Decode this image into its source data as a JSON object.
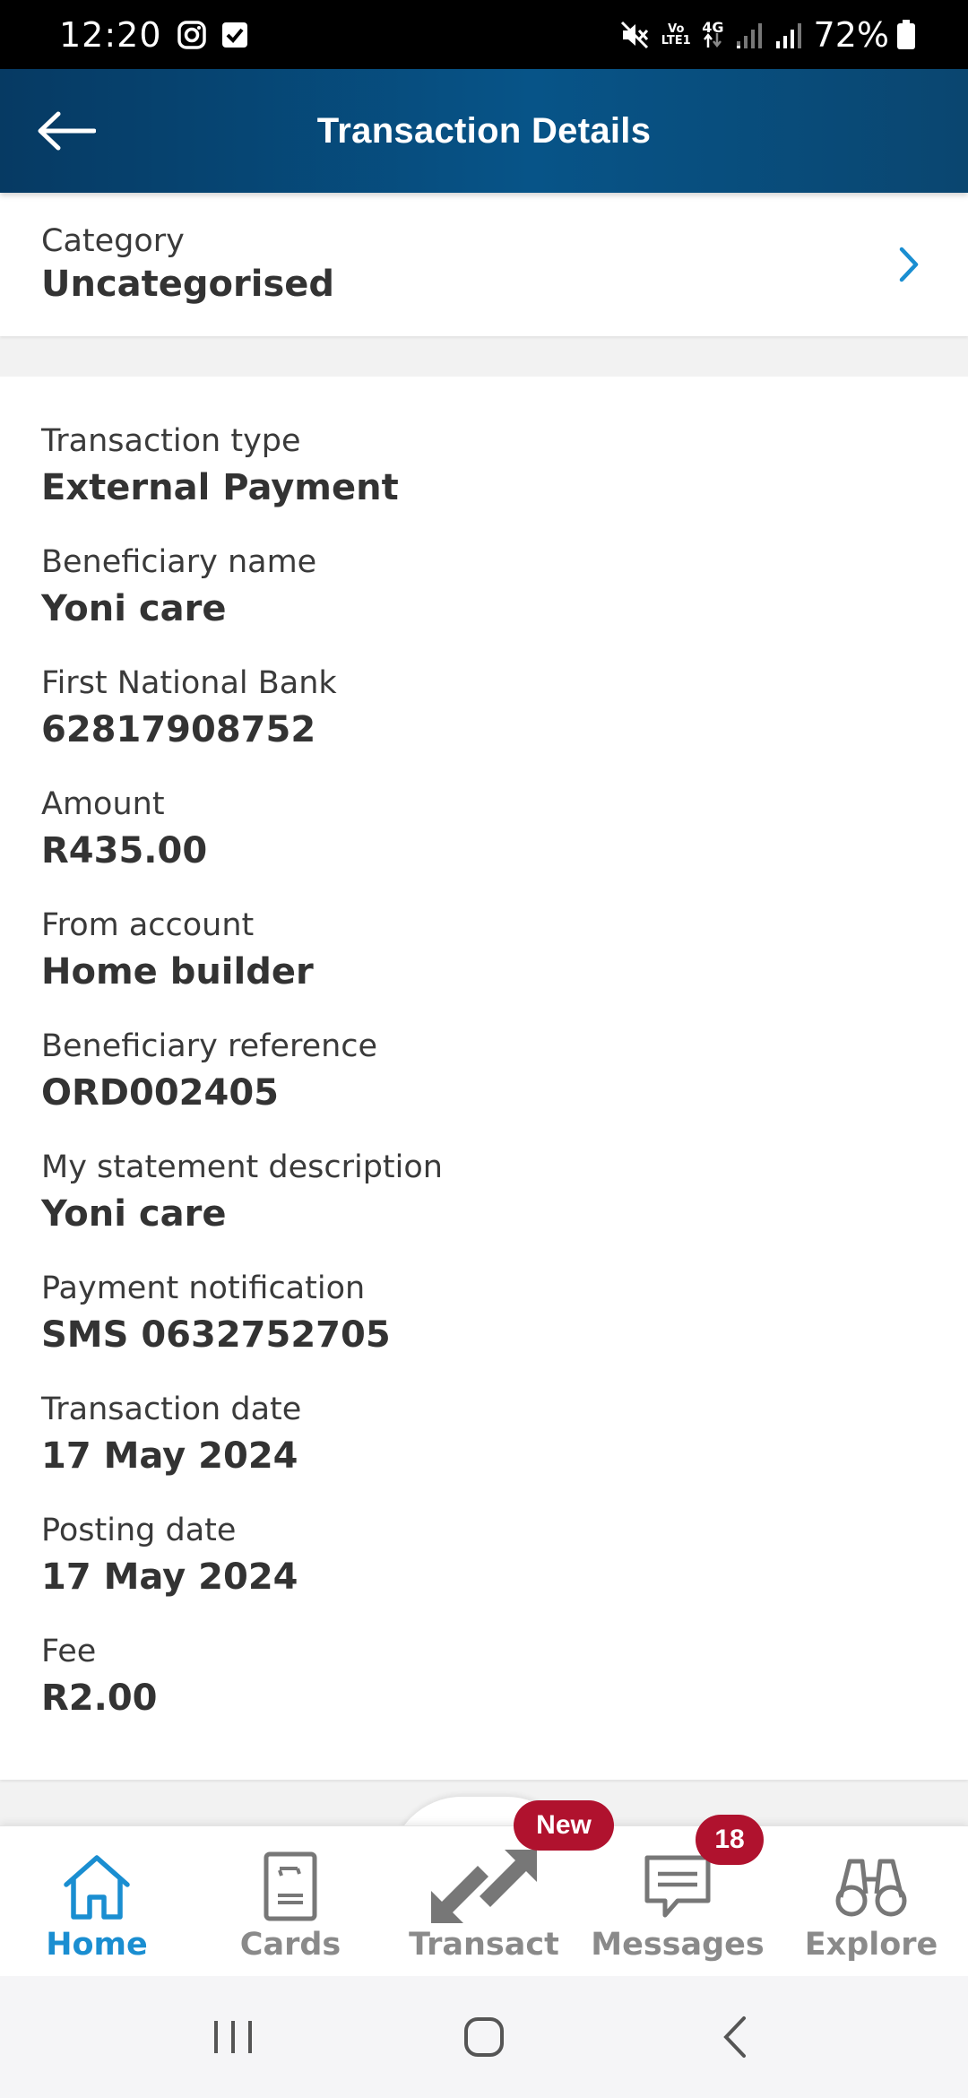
{
  "status_bar": {
    "time": "12:20",
    "battery": "72%",
    "volte_label": "Vo LTE1",
    "network_label": "4G"
  },
  "header": {
    "title": "Transaction Details",
    "back_icon": "arrow-left-icon"
  },
  "category": {
    "label": "Category",
    "value": "Uncategorised"
  },
  "details": [
    {
      "label": "Transaction type",
      "value": "External Payment"
    },
    {
      "label": "Beneficiary name",
      "value": "Yoni care"
    },
    {
      "label": "First National Bank",
      "value": "62817908752"
    },
    {
      "label": "Amount",
      "value": "R435.00"
    },
    {
      "label": "From account",
      "value": "Home builder"
    },
    {
      "label": "Beneficiary reference",
      "value": "ORD002405"
    },
    {
      "label": "My statement description",
      "value": "Yoni care"
    },
    {
      "label": "Payment notification",
      "value": "SMS 0632752705"
    },
    {
      "label": "Transaction date",
      "value": "17 May 2024"
    },
    {
      "label": "Posting date",
      "value": "17 May 2024"
    },
    {
      "label": "Fee",
      "value": "R2.00"
    }
  ],
  "bottom_nav": {
    "items": [
      {
        "label": "Home",
        "icon": "home-icon",
        "active": true
      },
      {
        "label": "Cards",
        "icon": "card-icon",
        "active": false
      },
      {
        "label": "Transact",
        "icon": "transact-arrows-icon",
        "active": false
      },
      {
        "label": "Messages",
        "icon": "message-icon",
        "active": false
      },
      {
        "label": "Explore",
        "icon": "binoculars-icon",
        "active": false
      }
    ],
    "transact_badge": "New",
    "messages_badge": "18"
  },
  "colors": {
    "header": "#075488",
    "accent": "#1a8ed1",
    "badge": "#b0122e"
  }
}
